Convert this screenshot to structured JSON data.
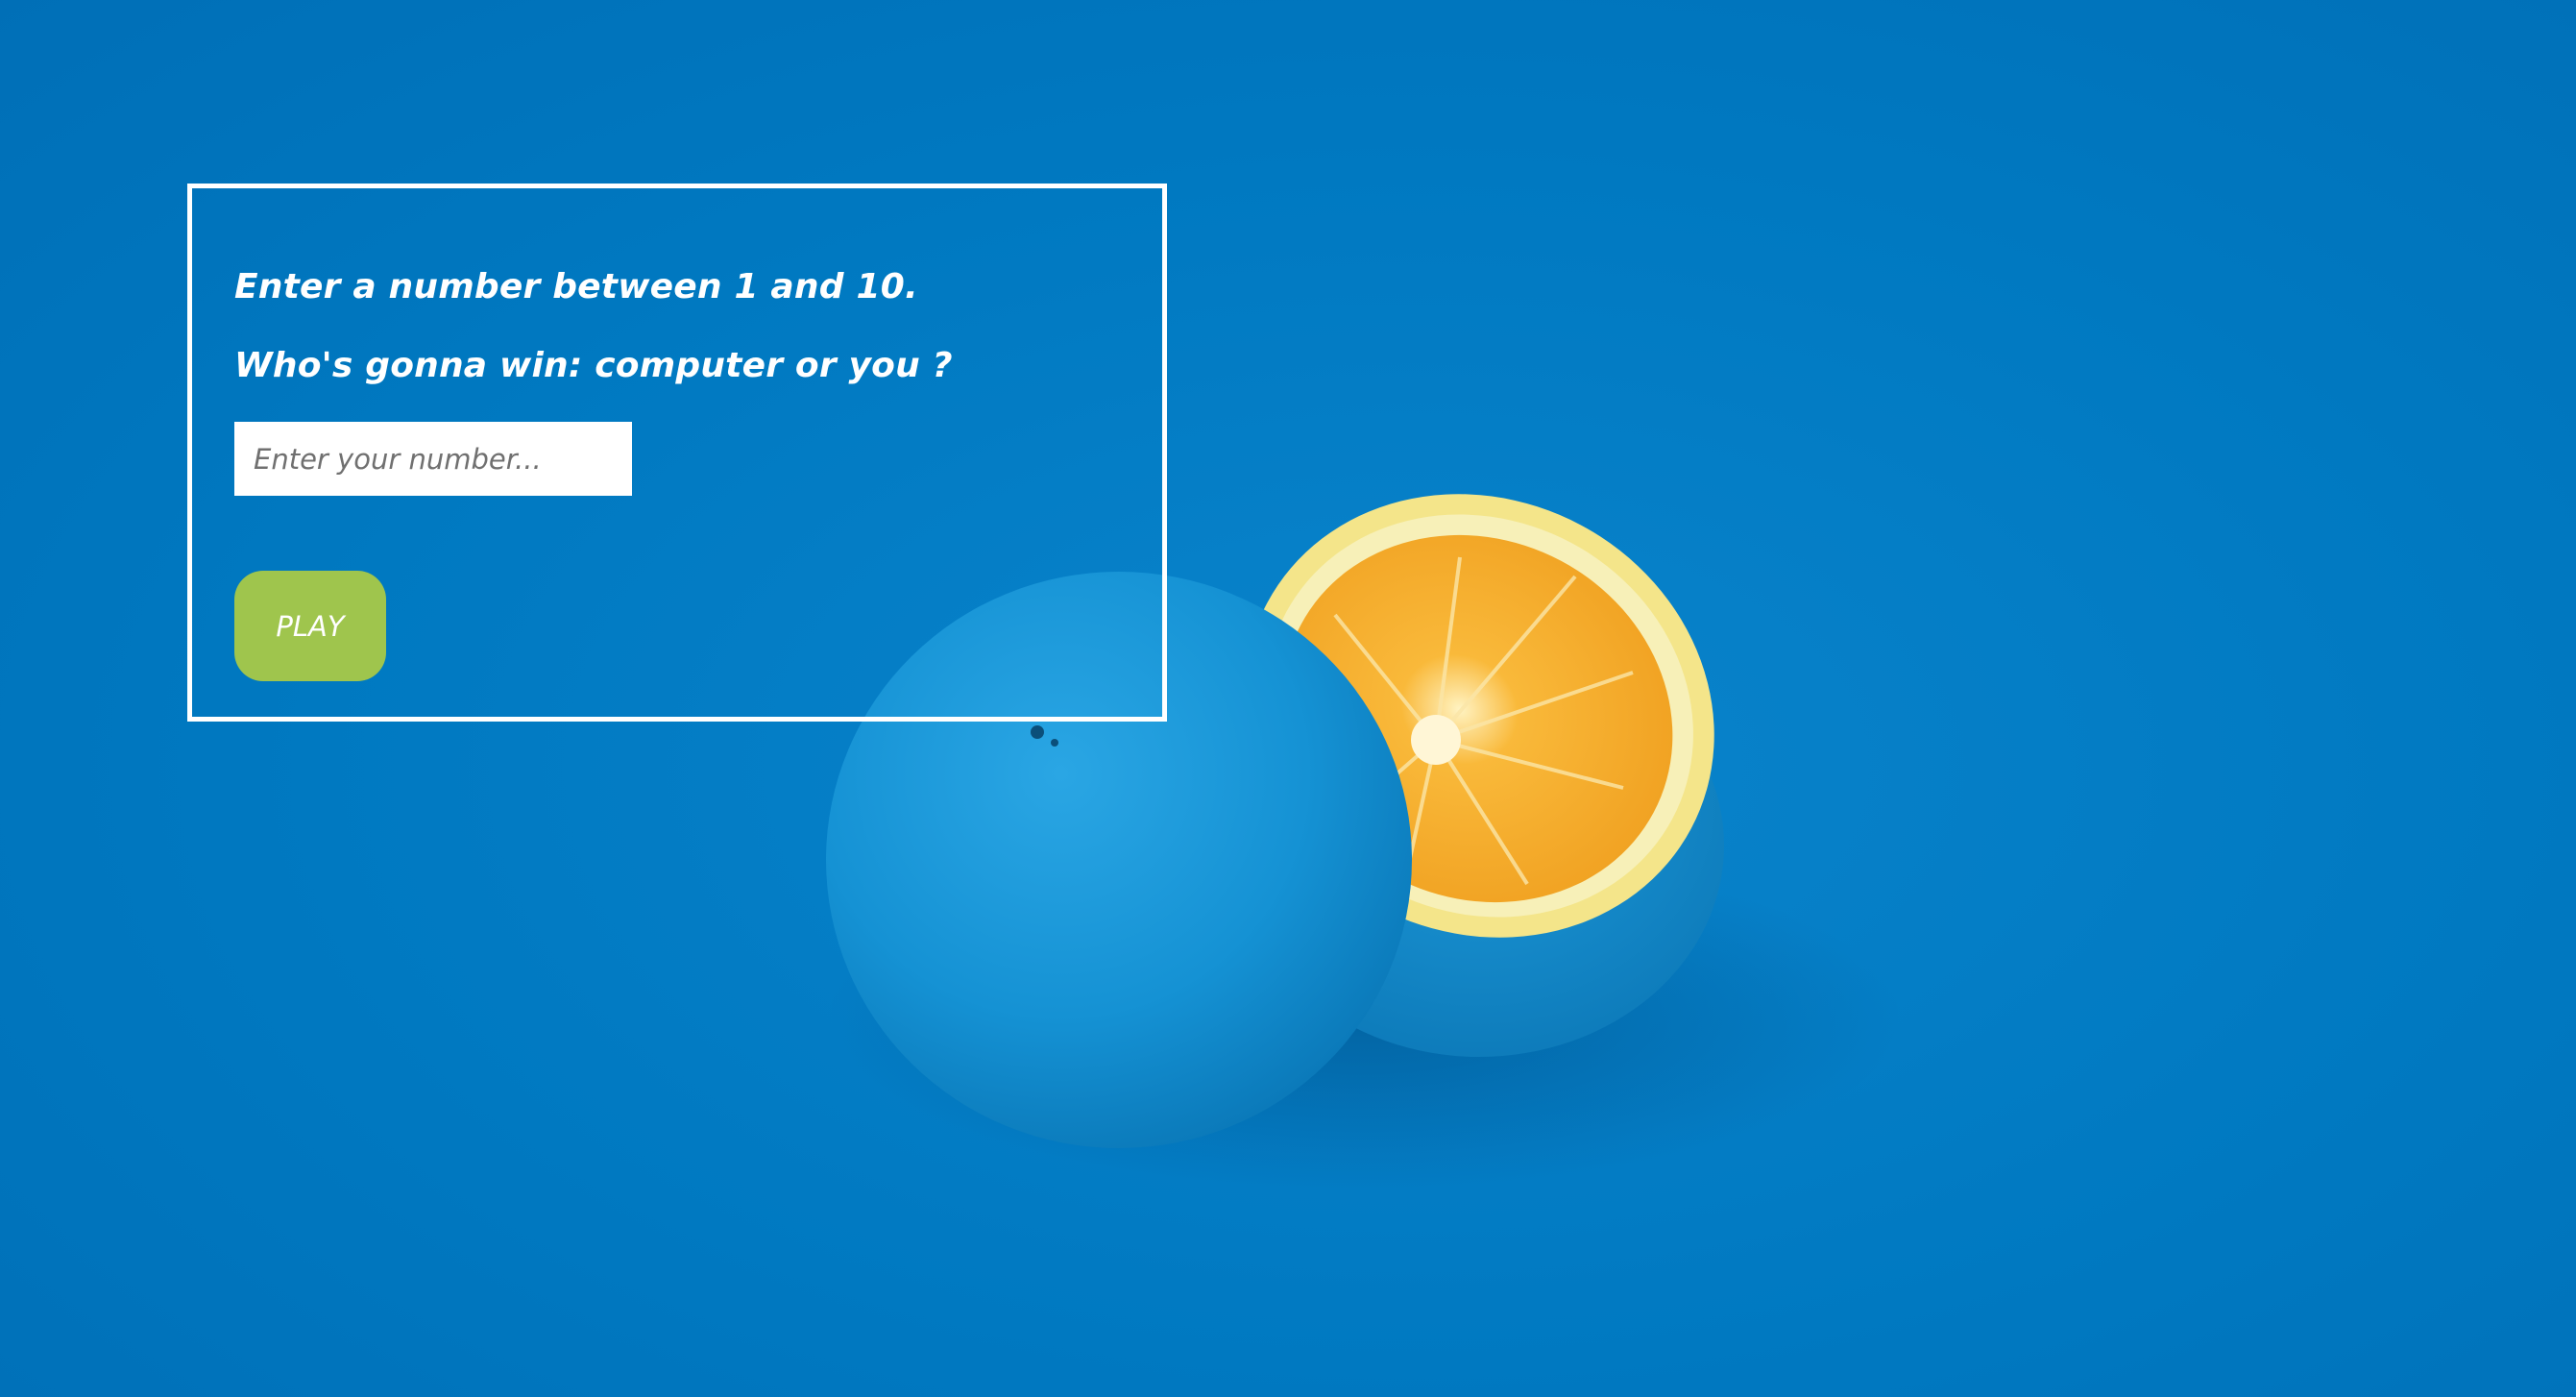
{
  "game": {
    "instruction": "Enter a number between 1 and 10.",
    "question": "Who's gonna win: computer or you ?",
    "input": {
      "placeholder": "Enter your number...",
      "value": ""
    },
    "play_label": "PLAY"
  },
  "colors": {
    "background": "#0079c1",
    "box_border": "#ffffff",
    "play_button": "#9fc54d",
    "orange_flesh": "#f5a623",
    "orange_rind_blue": "#1592d4"
  }
}
